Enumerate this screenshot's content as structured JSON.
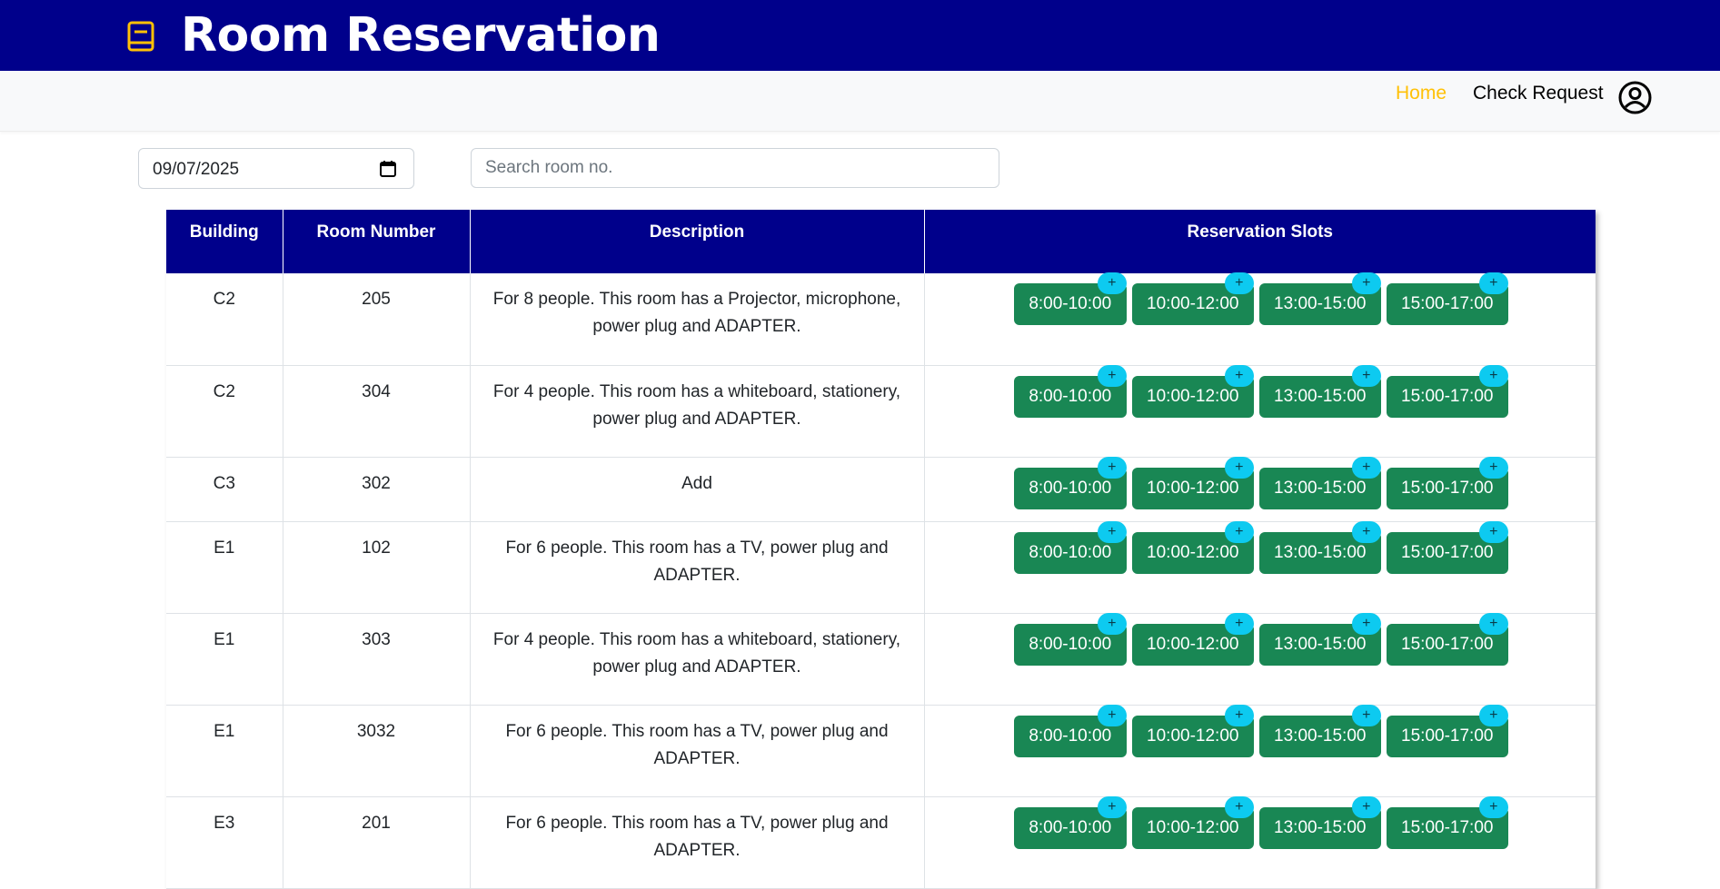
{
  "header": {
    "title": "Room Reservation",
    "icon": "book-icon"
  },
  "nav": {
    "home": "Home",
    "check_request": "Check Request",
    "user_icon": "user-circle-icon"
  },
  "filters": {
    "date_value": "09/07/2025",
    "search_placeholder": "Search room no."
  },
  "table": {
    "headers": [
      "Building",
      "Room Number",
      "Description",
      "Reservation Slots"
    ],
    "slot_add_label": "+",
    "rows": [
      {
        "building": "C2",
        "room": "205",
        "desc_lines": [
          "For 8 people. This room has a Projector, microphone,",
          "power plug and ADAPTER."
        ],
        "slots": [
          "8:00-10:00",
          "10:00-12:00",
          "13:00-15:00",
          "15:00-17:00"
        ]
      },
      {
        "building": "C2",
        "room": "304",
        "desc_lines": [
          "For 4 people. This room has a whiteboard, stationery,",
          "power plug and ADAPTER."
        ],
        "slots": [
          "8:00-10:00",
          "10:00-12:00",
          "13:00-15:00",
          "15:00-17:00"
        ]
      },
      {
        "building": "C3",
        "room": "302",
        "desc_lines": [
          "Add"
        ],
        "slots": [
          "8:00-10:00",
          "10:00-12:00",
          "13:00-15:00",
          "15:00-17:00"
        ]
      },
      {
        "building": "E1",
        "room": "102",
        "desc_lines": [
          "For 6 people. This room has a TV, power plug and",
          "ADAPTER."
        ],
        "slots": [
          "8:00-10:00",
          "10:00-12:00",
          "13:00-15:00",
          "15:00-17:00"
        ]
      },
      {
        "building": "E1",
        "room": "303",
        "desc_lines": [
          "For 4 people. This room has a whiteboard, stationery,",
          "power plug and ADAPTER."
        ],
        "slots": [
          "8:00-10:00",
          "10:00-12:00",
          "13:00-15:00",
          "15:00-17:00"
        ]
      },
      {
        "building": "E1",
        "room": "3032",
        "desc_lines": [
          "For 6 people. This room has a TV, power plug and",
          "ADAPTER."
        ],
        "slots": [
          "8:00-10:00",
          "10:00-12:00",
          "13:00-15:00",
          "15:00-17:00"
        ]
      },
      {
        "building": "E3",
        "room": "201",
        "desc_lines": [
          "For 6 people. This room has a TV, power plug and",
          "ADAPTER."
        ],
        "slots": [
          "8:00-10:00",
          "10:00-12:00",
          "13:00-15:00",
          "15:00-17:00"
        ]
      }
    ]
  },
  "colors": {
    "header_bg": "#00008b",
    "accent": "#ffc107",
    "slot_bg": "#198754",
    "add_badge": "#0dcaf0"
  }
}
